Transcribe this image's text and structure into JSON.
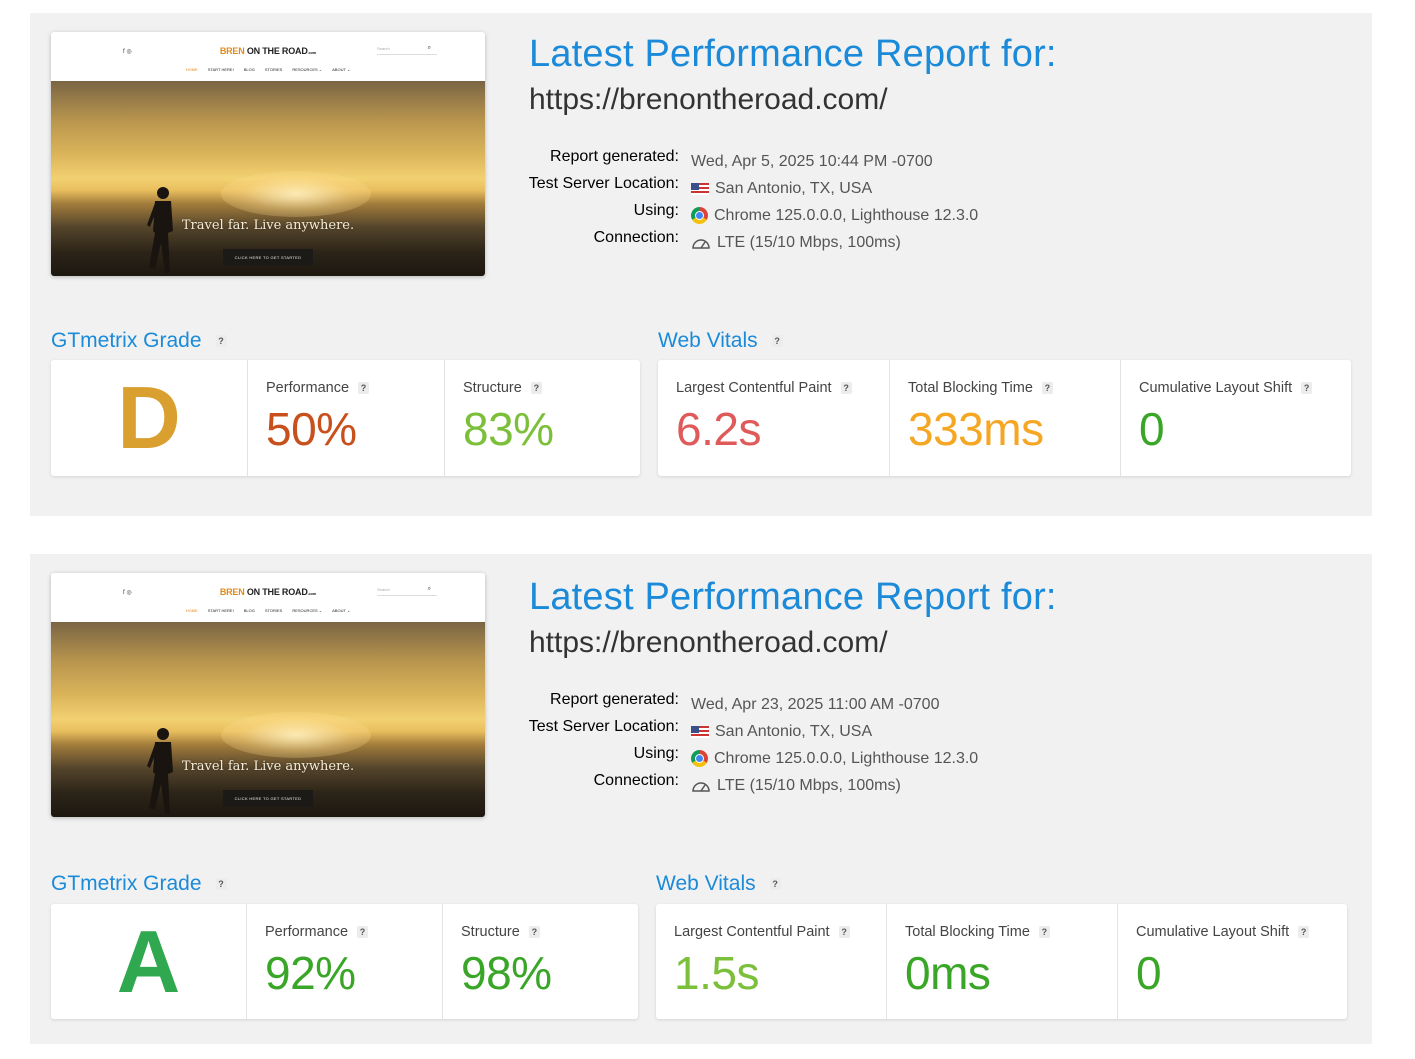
{
  "reports": [
    {
      "title": "Latest Performance Report for:",
      "url": "https://brenontheroad.com/",
      "meta": {
        "report_generated_label": "Report generated:",
        "report_generated": "Wed, Apr 5, 2025 10:44 PM -0700",
        "server_location_label": "Test Server Location:",
        "server_location": "San Antonio, TX, USA",
        "using_label": "Using:",
        "using": "Chrome 125.0.0.0, Lighthouse 12.3.0",
        "connection_label": "Connection:",
        "connection": "LTE (15/10 Mbps, 100ms)"
      },
      "thumbnail": {
        "logo_bren": "BREN",
        "logo_rest": " ON THE ROAD",
        "logo_com": ".com",
        "search": "Search",
        "menu": [
          "HOME",
          "START HERE!",
          "BLOG",
          "STORIES",
          "RESOURCES ⌄",
          "ABOUT ⌄"
        ],
        "tagline": "Travel far. Live anywhere.",
        "cta": "CLICK HERE TO GET STARTED"
      },
      "grade": {
        "heading": "GTmetrix Grade",
        "letter": "D",
        "letter_color": "#d9a030",
        "performance_label": "Performance",
        "performance": "50%",
        "performance_color": "#c8501c",
        "structure_label": "Structure",
        "structure": "83%",
        "structure_color": "#7cbf3a"
      },
      "vitals": {
        "heading": "Web Vitals",
        "lcp_label": "Largest Contentful Paint",
        "lcp": "6.2s",
        "lcp_color": "#e05a5a",
        "tbt_label": "Total Blocking Time",
        "tbt": "333ms",
        "tbt_color": "#f5a623",
        "cls_label": "Cumulative Layout Shift",
        "cls": "0",
        "cls_color": "#3aa628"
      }
    },
    {
      "title": "Latest Performance Report for:",
      "url": "https://brenontheroad.com/",
      "meta": {
        "report_generated_label": "Report generated:",
        "report_generated": "Wed, Apr 23, 2025 11:00 AM -0700",
        "server_location_label": "Test Server Location:",
        "server_location": "San Antonio, TX, USA",
        "using_label": "Using:",
        "using": "Chrome 125.0.0.0, Lighthouse 12.3.0",
        "connection_label": "Connection:",
        "connection": "LTE (15/10 Mbps, 100ms)"
      },
      "thumbnail": {
        "logo_bren": "BREN",
        "logo_rest": " ON THE ROAD",
        "logo_com": ".com",
        "search": "Search",
        "menu": [
          "HOME",
          "START HERE!",
          "BLOG",
          "STORIES",
          "RESOURCES ⌄",
          "ABOUT ⌄"
        ],
        "tagline": "Travel far. Live anywhere.",
        "cta": "CLICK HERE TO GET STARTED"
      },
      "grade": {
        "heading": "GTmetrix Grade",
        "letter": "A",
        "letter_color": "#2fa84f",
        "performance_label": "Performance",
        "performance": "92%",
        "performance_color": "#3aa628",
        "structure_label": "Structure",
        "structure": "98%",
        "structure_color": "#3aa628"
      },
      "vitals": {
        "heading": "Web Vitals",
        "lcp_label": "Largest Contentful Paint",
        "lcp": "1.5s",
        "lcp_color": "#7cbf3a",
        "tbt_label": "Total Blocking Time",
        "tbt": "0ms",
        "tbt_color": "#3aa628",
        "cls_label": "Cumulative Layout Shift",
        "cls": "0",
        "cls_color": "#3aa628"
      }
    }
  ],
  "icons": {
    "help": "?",
    "flag": "us-flag-icon",
    "browser": "chrome-icon",
    "connection": "gauge-icon",
    "social": "f ◎",
    "search": "⌕"
  }
}
